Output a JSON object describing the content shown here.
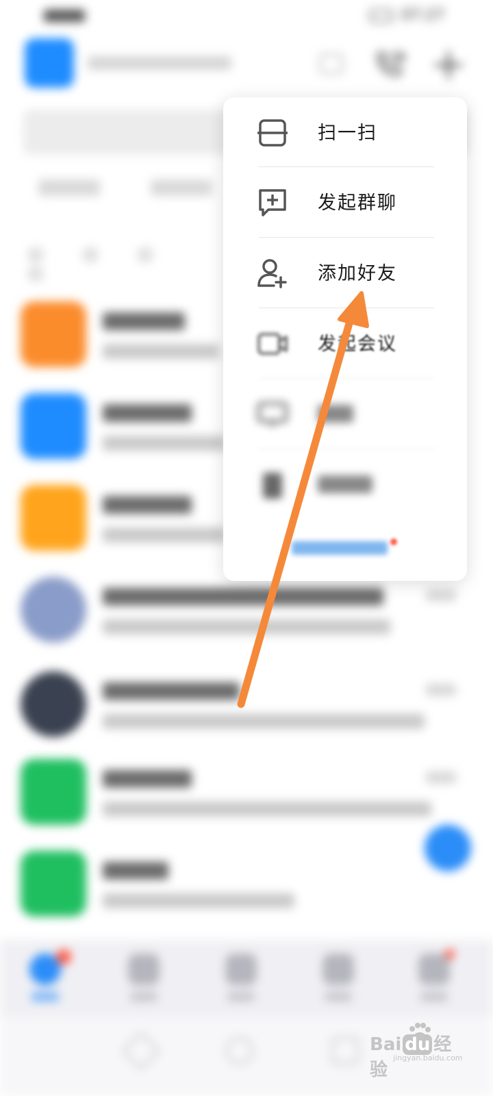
{
  "status_bar": {
    "time": "07:27",
    "battery_level": "83"
  },
  "menu": {
    "items": [
      {
        "label": "扫一扫",
        "icon": "scan-icon",
        "blurred": false
      },
      {
        "label": "发起群聊",
        "icon": "group-chat-icon",
        "blurred": false
      },
      {
        "label": "添加好友",
        "icon": "add-friend-icon",
        "blurred": false
      },
      {
        "label": "发起会议",
        "icon": "video-meeting-icon",
        "blurred": true
      },
      {
        "label": "",
        "icon": "screen-share-icon",
        "blurred": true
      },
      {
        "label": "",
        "icon": "clipboard-icon",
        "blurred": true
      }
    ]
  },
  "watermark": {
    "brand": "Bai",
    "brand_suffix": "经验",
    "site": "jingyan.baidu.com"
  },
  "colors": {
    "accent": "#2b8df8",
    "arrow": "#f5893a",
    "badge": "#ff5a45",
    "avatar_orange": "#fb8c2c",
    "avatar_blue": "#1e8cff",
    "avatar_amber": "#ffa41c",
    "avatar_green": "#1fbf60"
  }
}
